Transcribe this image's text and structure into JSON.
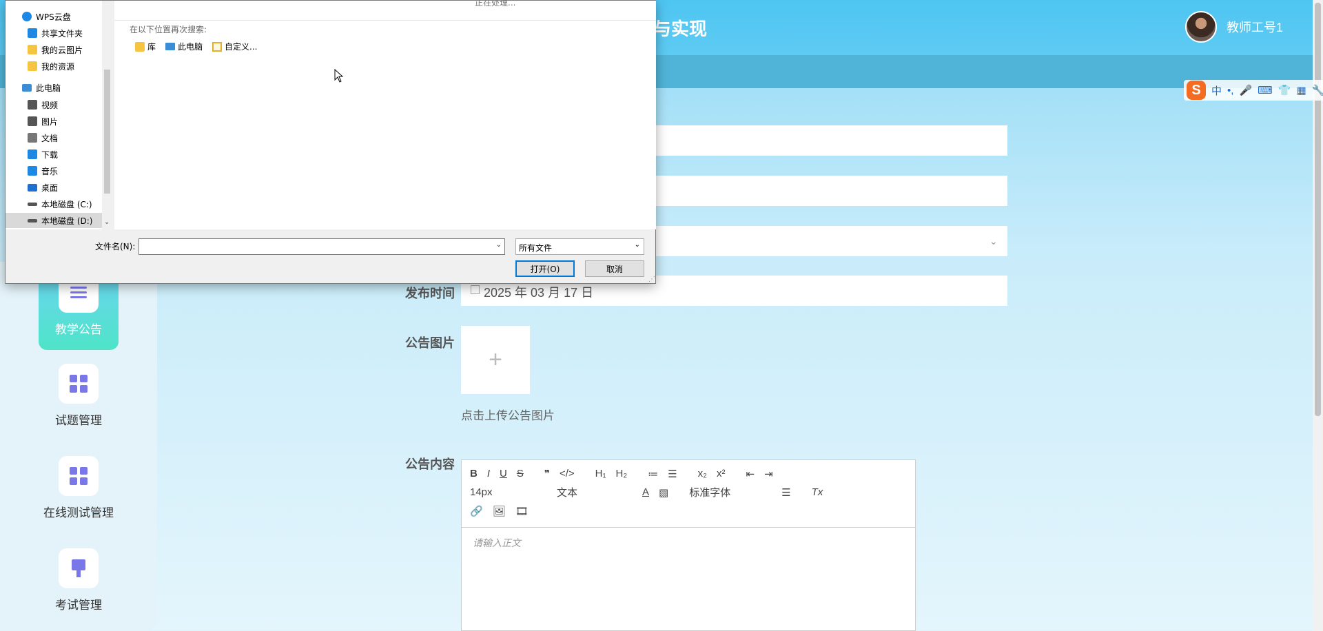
{
  "app": {
    "title": "与实现",
    "user_name": "教师工号1"
  },
  "ime": {
    "logo": "S",
    "mode": "中",
    "punct": "•,",
    "tools": [
      "🎤",
      "⌨",
      "👕",
      "▦",
      "🔧"
    ]
  },
  "sidebar": {
    "items": [
      {
        "label": "教学公告",
        "icon": "sliders-icon",
        "active": true
      },
      {
        "label": "试题管理",
        "icon": "grid-icon"
      },
      {
        "label": "在线测试管理",
        "icon": "grid-icon"
      },
      {
        "label": "考试管理",
        "icon": "brush-icon"
      }
    ]
  },
  "form": {
    "publish_time_label": "发布时间",
    "publish_time_value": "2025 年 03 月 17 日",
    "image_label": "公告图片",
    "upload_plus": "+",
    "upload_hint": "点击上传公告图片",
    "content_label": "公告内容"
  },
  "editor": {
    "row1": [
      "B",
      "I",
      "U",
      "S",
      "❞",
      "</>",
      "H₁",
      "H₂",
      "≔",
      "☰",
      "x₂",
      "x²",
      "⇤",
      "⇥"
    ],
    "font_size": "14px",
    "text_style": "文本",
    "font_family": "标准字体",
    "clear": "Tx",
    "placeholder": "请输入正文"
  },
  "dialog": {
    "processing": "正在处理...",
    "search_again": "在以下位置再次搜索:",
    "locations": [
      "库",
      "此电脑",
      "自定义..."
    ],
    "nav": [
      {
        "label": "WPS云盘",
        "icon": "cloud-icon",
        "color": "#1e88e5"
      },
      {
        "label": "共享文件夹",
        "icon": "share-icon",
        "color": "#1e88e5"
      },
      {
        "label": "我的云图片",
        "icon": "folder-icon",
        "color": "#f5c542"
      },
      {
        "label": "我的资源",
        "icon": "folder-icon",
        "color": "#f5c542"
      },
      {
        "label": "此电脑",
        "icon": "computer-icon",
        "color": "#3b8dd6"
      },
      {
        "label": "视频",
        "icon": "video-icon",
        "color": "#555555"
      },
      {
        "label": "图片",
        "icon": "picture-icon",
        "color": "#555555"
      },
      {
        "label": "文档",
        "icon": "document-icon",
        "color": "#777777"
      },
      {
        "label": "下载",
        "icon": "download-icon",
        "color": "#1e88e5"
      },
      {
        "label": "音乐",
        "icon": "music-icon",
        "color": "#1e88e5"
      },
      {
        "label": "桌面",
        "icon": "desktop-icon",
        "color": "#1e6fd0"
      },
      {
        "label": "本地磁盘 (C:)",
        "icon": "disk-icon",
        "color": "#555555"
      },
      {
        "label": "本地磁盘 (D:)",
        "icon": "disk-icon",
        "color": "#555555"
      }
    ],
    "filename_label": "文件名(N):",
    "filename_value": "",
    "filetype": "所有文件",
    "open_button": "打开(O)",
    "cancel_button": "取消"
  }
}
